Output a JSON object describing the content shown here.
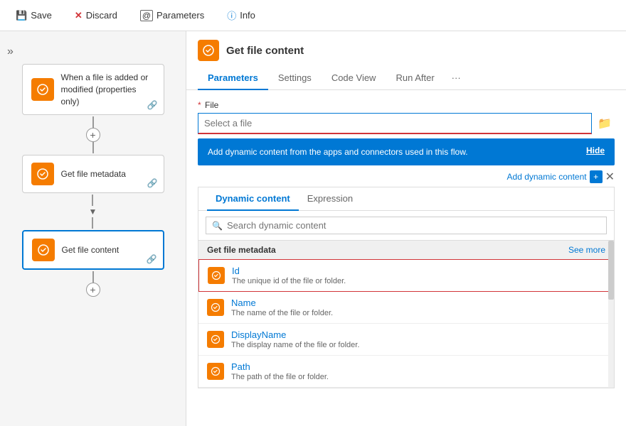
{
  "toolbar": {
    "save_label": "Save",
    "discard_label": "Discard",
    "parameters_label": "Parameters",
    "info_label": "Info"
  },
  "flow": {
    "chevron": "»",
    "nodes": [
      {
        "id": "trigger",
        "title": "When a file is added or modified (properties only)",
        "active": false
      },
      {
        "id": "metadata",
        "title": "Get file metadata",
        "active": false
      },
      {
        "id": "content",
        "title": "Get file content",
        "active": true
      }
    ]
  },
  "action": {
    "title": "Get file content",
    "tabs": [
      "Parameters",
      "Settings",
      "Code View",
      "Run After"
    ],
    "active_tab": "Parameters",
    "more_label": "···"
  },
  "file_field": {
    "label": "File",
    "required": true,
    "placeholder": "Select a file"
  },
  "dynamic_banner": {
    "text": "Add dynamic content from the apps and connectors used in this flow.",
    "hide_label": "Hide"
  },
  "add_dynamic": {
    "label": "Add dynamic content",
    "close_label": "✕"
  },
  "dynamic_panel": {
    "tabs": [
      "Dynamic content",
      "Expression"
    ],
    "active_tab": "Dynamic content",
    "search_placeholder": "Search dynamic content",
    "section_title": "Get file metadata",
    "see_more_label": "See more",
    "items": [
      {
        "id": "id",
        "name": "Id",
        "desc": "The unique id of the file or folder.",
        "selected": true
      },
      {
        "id": "name",
        "name": "Name",
        "desc": "The name of the file or folder.",
        "selected": false
      },
      {
        "id": "displayname",
        "name": "DisplayName",
        "desc": "The display name of the file or folder.",
        "selected": false
      },
      {
        "id": "path",
        "name": "Path",
        "desc": "The path of the file or folder.",
        "selected": false
      }
    ]
  },
  "icons": {
    "save": "💾",
    "discard": "✕",
    "parameters": "[@]",
    "info": "ⓘ",
    "flow_node": "⚙",
    "folder": "📁",
    "search": "🔍",
    "chevron_down": "▾",
    "close": "✕",
    "plus": "+",
    "link": "🔗"
  },
  "colors": {
    "accent": "#0078d4",
    "orange": "#f57c00",
    "error": "#d13438",
    "banner_bg": "#0078d4"
  }
}
